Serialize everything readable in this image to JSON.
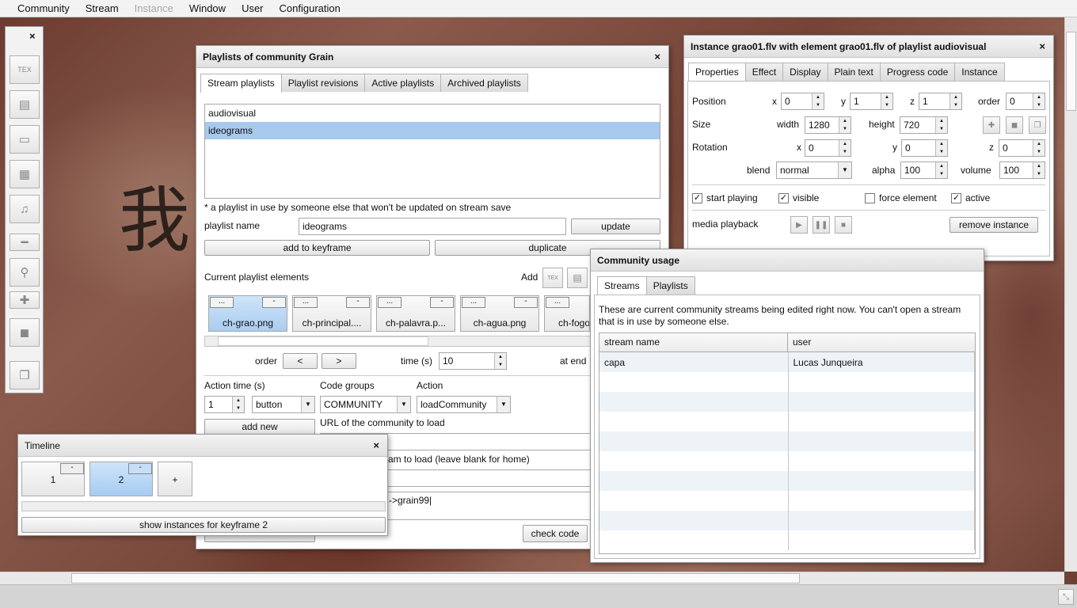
{
  "menubar": {
    "items": [
      "Community",
      "Stream",
      "Instance",
      "Window",
      "User",
      "Configuration"
    ]
  },
  "toolbox": {
    "close": "×",
    "items": [
      "tex-icon",
      "document-icon",
      "rectangle-icon",
      "video-icon",
      "music-icon",
      "minus-icon",
      "search-icon",
      "plus-icon",
      "square-icon",
      "windows-icon"
    ],
    "glyphs": {
      "tex": "TEX",
      "doc": "▤",
      "rect": "▭",
      "video": "▦",
      "music": "♫",
      "minus": "━",
      "search": "⚲",
      "plus": "✚",
      "square": "◼",
      "windows": "❐"
    }
  },
  "playlists": {
    "title": "Playlists of community Grain",
    "tabs": [
      "Stream playlists",
      "Playlist revisions",
      "Active playlists",
      "Archived playlists"
    ],
    "list": [
      "audiovisual",
      "ideograms"
    ],
    "note": "* a playlist in use by someone else that won't be updated on stream save",
    "name_label": "playlist name",
    "name_value": "ideograms",
    "update": "update",
    "add_keyframe": "add to keyframe",
    "duplicate": "duplicate",
    "current_label": "Current playlist elements",
    "add_label": "Add",
    "elements": [
      {
        "name": "ch-grao.png"
      },
      {
        "name": "ch-principal...."
      },
      {
        "name": "ch-palavra.p..."
      },
      {
        "name": "ch-agua.png"
      },
      {
        "name": "ch-fogo"
      }
    ],
    "more": "...",
    "minus": "-",
    "order_label": "order",
    "prev": "<",
    "next": ">",
    "time_label": "time (s)",
    "time_value": "10",
    "at_end": "at end",
    "action_time_label": "Action time (s)",
    "action_time_value": "1",
    "action_type": "button",
    "code_groups_label": "Code groups",
    "code_group_value": "COMMUNITY",
    "action_label": "Action",
    "action_value": "loadCommunity",
    "add_new": "add new",
    "url_label": "URL of the community to load",
    "stream_label_partial": "am to load (leave blank for home)",
    "code_partial": "->grain99|",
    "check_code": "check code",
    "close": "×"
  },
  "timeline": {
    "title": "Timeline",
    "keyframes": [
      "1",
      "2"
    ],
    "plus": "+",
    "minus": "-",
    "show": "show instances for keyframe 2",
    "close": "×"
  },
  "instance": {
    "title": "Instance grao01.flv with element grao01.flv of playlist audiovisual",
    "tabs": [
      "Properties",
      "Effect",
      "Display",
      "Plain text",
      "Progress code",
      "Instance"
    ],
    "position": "Position",
    "x": "x",
    "y": "y",
    "z": "z",
    "order": "order",
    "px": "0",
    "py": "1",
    "pz": "1",
    "porder": "0",
    "size": "Size",
    "width": "width",
    "height": "height",
    "w": "1280",
    "h": "720",
    "rotation": "Rotation",
    "rx": "0",
    "ry": "0",
    "rz": "0",
    "blend": "blend",
    "blend_value": "normal",
    "alpha": "alpha",
    "alpha_value": "100",
    "volume": "volume",
    "volume_value": "100",
    "start_playing": "start playing",
    "visible": "visible",
    "force_element": "force element",
    "active": "active",
    "media_playback": "media playback",
    "remove": "remove instance",
    "check": "✓",
    "close": "×"
  },
  "usage": {
    "title": "Community usage",
    "tabs": [
      "Streams",
      "Playlists"
    ],
    "desc": "These are current community streams being edited right now. You can't open a stream that is in use by someone else.",
    "col_stream": "stream name",
    "col_user": "user",
    "rows": [
      {
        "stream": "capa",
        "user": "Lucas Junqueira"
      }
    ]
  },
  "decor": {
    "glyph": "我"
  }
}
